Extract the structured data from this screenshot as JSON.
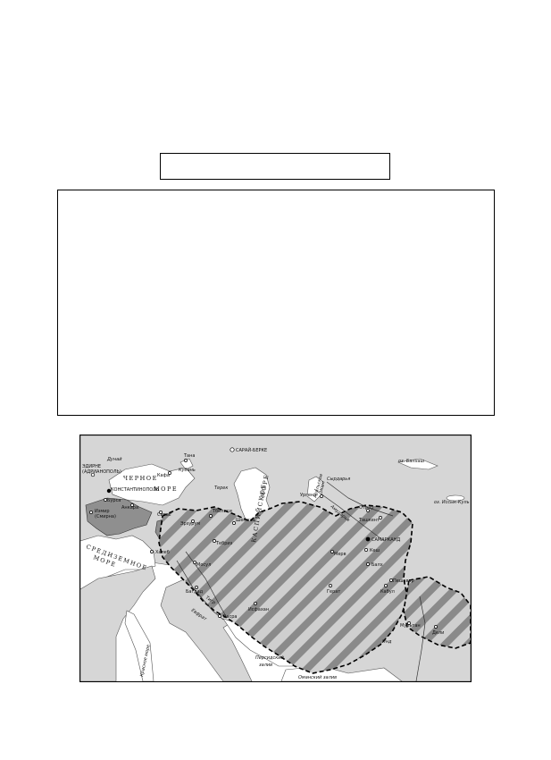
{
  "answer_box": {
    "text": ""
  },
  "answer_area": {
    "text": ""
  },
  "map": {
    "colors": {
      "land": "#d3d3d3",
      "sea": "#ffffff",
      "territory_dark": "#8f8f8f",
      "hatch": "#8a8a8a",
      "border": "#000000"
    },
    "seas": {
      "black_sea_1": "ЧЕРНОЕ",
      "black_sea_2": "МОРЕ",
      "caspian_1": "КАСПИЙСКОЕ",
      "caspian_2": "МОРЕ",
      "aral_1": "Аральское",
      "aral_2": "море",
      "mediterranean_1": "СРЕДИЗЕМНОЕ",
      "mediterranean_2": "МОРЕ",
      "red_sea": "Красное море",
      "persian_gulf_1": "Персидский",
      "persian_gulf_2": "залив",
      "oman_gulf": "Оманский залив",
      "balkhash": "оз. Балхаш",
      "issyk_kul": "оз. Иссык-Куль"
    },
    "rivers": {
      "dunai": "Дунай",
      "amudarya": "Амударья",
      "syrdarya": "Сырдарья",
      "terek": "Терек",
      "tigr": "Тигр",
      "efrat": "Евфрат",
      "ind": "Инд",
      "otrar_river": "Отрар"
    },
    "cities": {
      "sarai_berke": "САРАЙ-БЕРКЕ",
      "edirne_1": "ЭДИРНЕ",
      "edirne_2": "(АДРИАНОПОЛЬ)",
      "constantinople": "КОНСТАНТИНОПОЛЬ",
      "tana": "Тана",
      "kaffa": "Кафа",
      "kuban": "Кубань",
      "bursa": "Бурса",
      "ankara": "Анкара",
      "sivas": "Сивас",
      "izmir_1": "Измир",
      "izmir_2": "(Смирна)",
      "erzurum": "Эрзурум",
      "dalep": "Халеб",
      "tbilisi": "Тбилиси",
      "shemakha": "Шемаха",
      "tabriz": "Тебриз",
      "mosul": "Мосул",
      "baghdad": "Багдад",
      "basra": "Басра",
      "isfahan": "Исфахан",
      "urgench": "Ургенч",
      "otrar": "Отрар",
      "tashkent": "Ташкент",
      "samarkand": "САМАРКАНД",
      "kesh": "Кеш",
      "balkh": "Балх",
      "merv": "Мерв",
      "herat": "Герат",
      "kabul": "Кабул",
      "peshawar": "Пешавар",
      "multan": "Мультан",
      "delhi": "Дели"
    }
  }
}
